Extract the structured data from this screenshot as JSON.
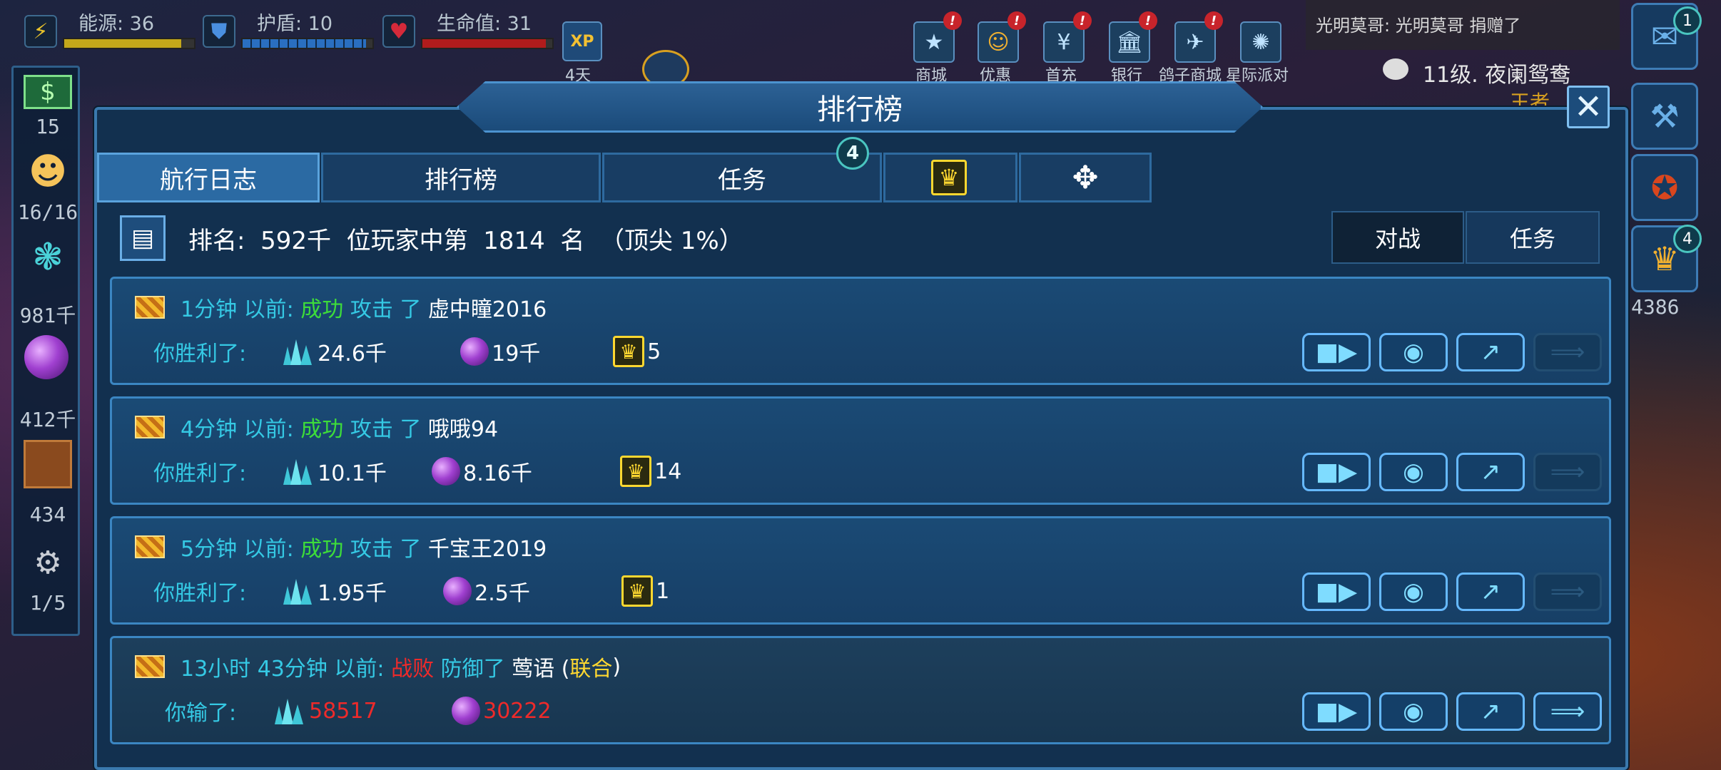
{
  "hud": {
    "energy": {
      "label": "能源: 36",
      "fill": 0.9,
      "color": "#c4a81a"
    },
    "shield": {
      "label": "护盾: 10",
      "fill": 0.95,
      "color": "#2a6fc0"
    },
    "health": {
      "label": "生命值: 31",
      "fill": 0.95,
      "color": "#b01c1c"
    },
    "xp_icon": "XP",
    "xp_days": "4天"
  },
  "top_menu": [
    {
      "label": "商城",
      "icon": "star-badge-icon"
    },
    {
      "label": "优惠",
      "icon": "sale-icon"
    },
    {
      "label": "首充",
      "icon": "yen-icon"
    },
    {
      "label": "银行",
      "icon": "bank-icon"
    },
    {
      "label": "鸽子商城",
      "icon": "bird-icon"
    },
    {
      "label": "星际派对",
      "icon": "burst-icon"
    }
  ],
  "chat": {
    "message": "光明莫哥: 光明莫哥 捐赠了",
    "player_line": "11级. 夜阑鸳鸯",
    "sub": "王者",
    "badge": "1"
  },
  "left_sidebar": {
    "money_count": "15",
    "crew": "16/16",
    "crystals": "981千",
    "orbs": "412千",
    "crates": "434",
    "ships": "1/5"
  },
  "right_sidebar": {
    "trophy_badge": "4",
    "trophy_count": "4386"
  },
  "panel": {
    "title": "排行榜",
    "tabs": [
      "航行日志",
      "排行榜",
      "任务",
      "",
      ""
    ],
    "task_badge": "4",
    "rank_text": "排名:  592千  位玩家中第  1814  名  （顶尖 1%）",
    "filters": [
      "对战",
      "任务"
    ]
  },
  "entries": [
    {
      "time": "1分钟 以前:",
      "result": "成功",
      "action": "攻击 了",
      "player": "虚中瞳2016",
      "alliance": "",
      "outcome": "你胜利了:",
      "crystals": "24.6千",
      "orbs": "19千",
      "trophies": "5",
      "won": true
    },
    {
      "time": "4分钟 以前:",
      "result": "成功",
      "action": "攻击 了",
      "player": "哦哦94",
      "alliance": "",
      "outcome": "你胜利了:",
      "crystals": "10.1千",
      "orbs": "8.16千",
      "trophies": "14",
      "won": true
    },
    {
      "time": "5分钟 以前:",
      "result": "成功",
      "action": "攻击 了",
      "player": "千宝王2019",
      "alliance": "",
      "outcome": "你胜利了:",
      "crystals": "1.95千",
      "orbs": "2.5千",
      "trophies": "1",
      "won": true
    },
    {
      "time": "13小时 43分钟 以前:",
      "result": "战败",
      "action": "防御了",
      "player": "莺语 (",
      "alliance": "联合",
      "outcome": "你输了:",
      "crystals": "58517",
      "orbs": "30222",
      "trophies": "",
      "won": false
    }
  ]
}
